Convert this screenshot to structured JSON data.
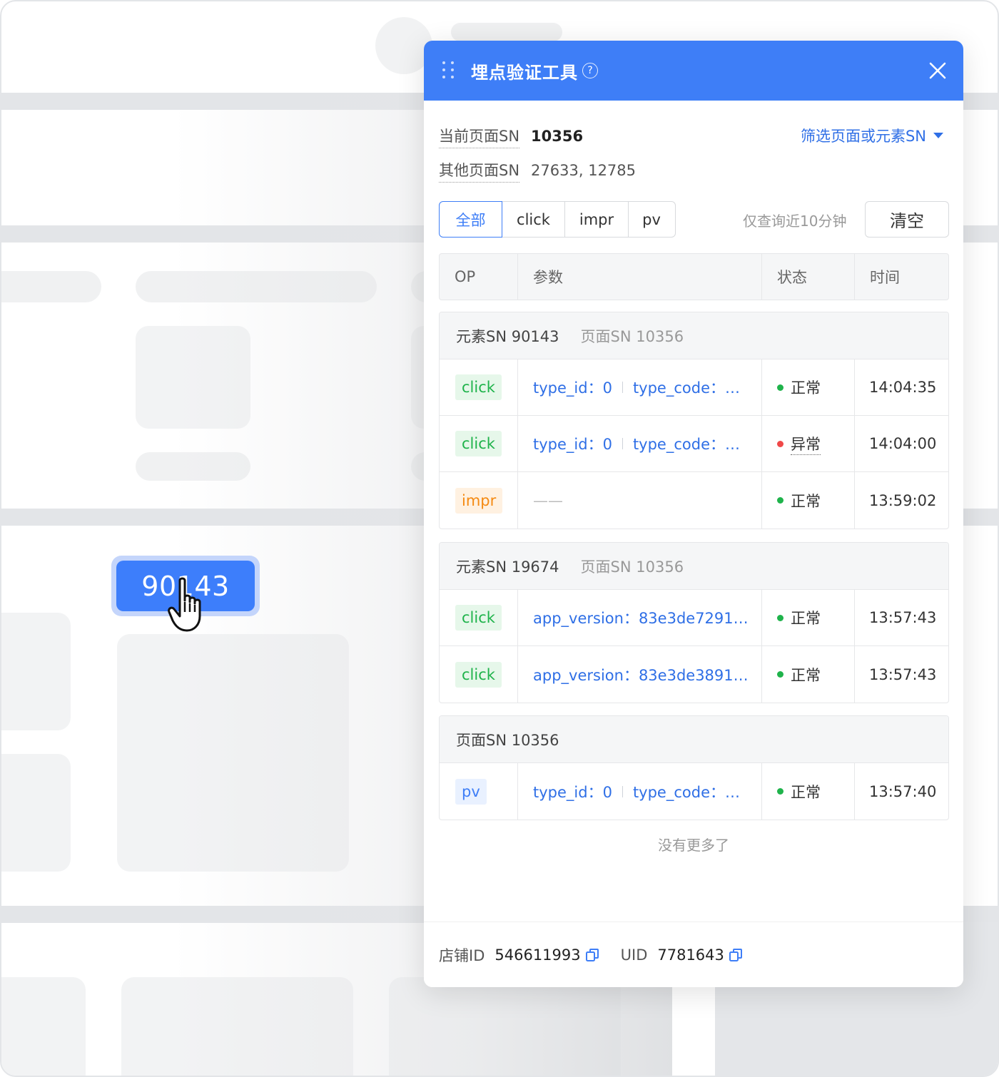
{
  "background": {
    "element_chip": "90143"
  },
  "panel": {
    "title": "埋点验证工具",
    "help_glyph": "?",
    "current_page_label": "当前页面SN",
    "current_page_value": "10356",
    "other_page_label": "其他页面SN",
    "other_page_value": "27633, 12785",
    "filter_label": "筛选页面或元素SN",
    "tabs": [
      "全部",
      "click",
      "impr",
      "pv"
    ],
    "active_tab": "全部",
    "recent_hint": "仅查询近10分钟",
    "clear_label": "清空",
    "columns": {
      "op": "OP",
      "params": "参数",
      "status": "状态",
      "time": "时间"
    },
    "groups": [
      {
        "element_sn": "元素SN 90143",
        "page_sn": "页面SN 10356",
        "rows": [
          {
            "op": "click",
            "param_a": "type_id：0",
            "param_b": "type_code：…",
            "status": "正常",
            "time": "14:04:35"
          },
          {
            "op": "click",
            "param_a": "type_id：0",
            "param_b": "type_code：…",
            "status": "异常",
            "time": "14:04:00"
          },
          {
            "op": "impr",
            "empty": "——",
            "status": "正常",
            "time": "13:59:02"
          }
        ]
      },
      {
        "element_sn": "元素SN 19674",
        "page_sn": "页面SN 10356",
        "rows": [
          {
            "op": "click",
            "param_a": "app_version：83e3de7291…",
            "status": "正常",
            "time": "13:57:43"
          },
          {
            "op": "click",
            "param_a": "app_version：83e3de3891…",
            "status": "正常",
            "time": "13:57:43"
          }
        ]
      },
      {
        "page_sn_only": "页面SN 10356",
        "rows": [
          {
            "op": "pv",
            "param_a": "type_id：0",
            "param_b": "type_code：…",
            "status": "正常",
            "time": "13:57:40"
          }
        ]
      }
    ],
    "no_more": "没有更多了",
    "footer": {
      "shop_label": "店铺ID",
      "shop_value": "546611993",
      "uid_label": "UID",
      "uid_value": "7781643"
    },
    "colors": {
      "accent": "#3e7ef7",
      "ok": "#1fb34b",
      "error": "#f04848",
      "click_badge": "#1fb34b",
      "impr_badge": "#f58a12",
      "pv_badge": "#3e7ef7"
    },
    "icons": [
      "drag-handle-icon",
      "help-icon",
      "close-icon",
      "caret-down-icon",
      "copy-icon"
    ]
  }
}
